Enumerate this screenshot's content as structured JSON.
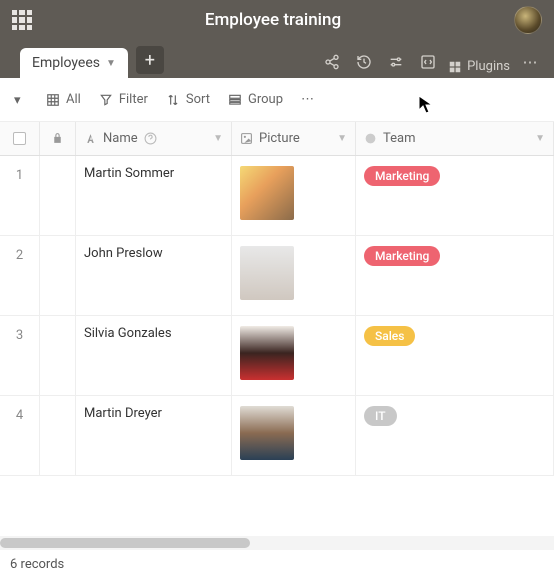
{
  "header": {
    "title": "Employee training"
  },
  "tabs": {
    "active": "Employees"
  },
  "tabbar": {
    "plugins_label": "Plugins"
  },
  "toolbar": {
    "all": "All",
    "filter": "Filter",
    "sort": "Sort",
    "group": "Group"
  },
  "columns": {
    "name": "Name",
    "picture": "Picture",
    "team": "Team"
  },
  "rows": [
    {
      "num": "1",
      "name": "Martin Sommer",
      "team": "Marketing",
      "team_class": "marketing"
    },
    {
      "num": "2",
      "name": "John Preslow",
      "team": "Marketing",
      "team_class": "marketing"
    },
    {
      "num": "3",
      "name": "Silvia Gonzales",
      "team": "Sales",
      "team_class": "sales"
    },
    {
      "num": "4",
      "name": "Martin Dreyer",
      "team": "IT",
      "team_class": "it"
    }
  ],
  "footer": {
    "records": "6 records"
  }
}
